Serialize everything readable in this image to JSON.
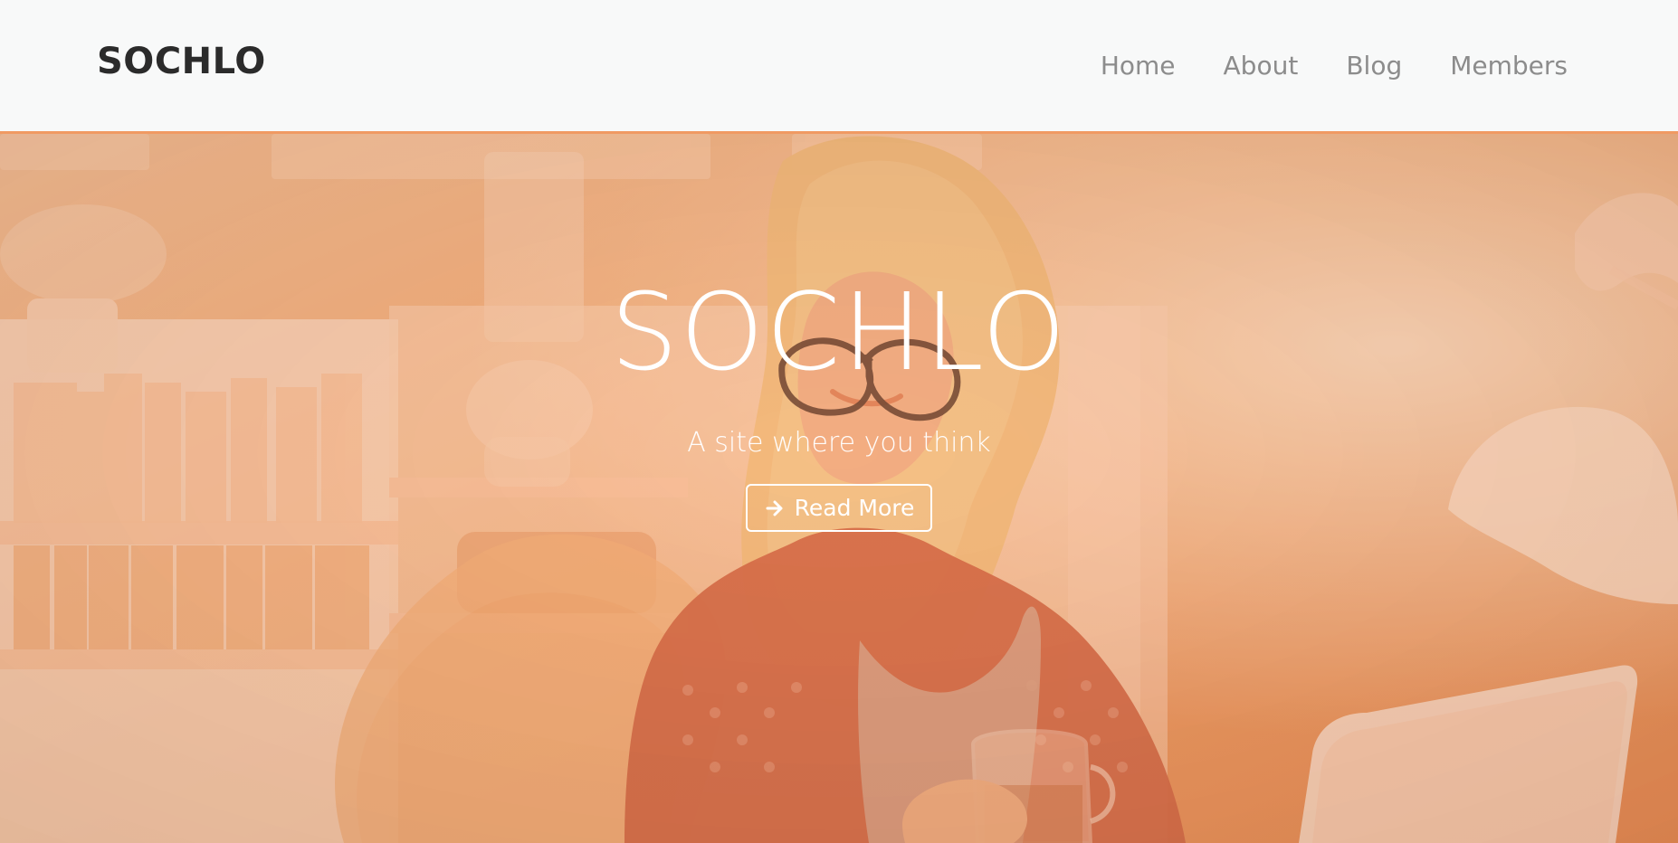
{
  "brand": "SOCHLO",
  "nav": {
    "items": [
      {
        "label": "Home"
      },
      {
        "label": "About"
      },
      {
        "label": "Blog"
      },
      {
        "label": "Members"
      }
    ]
  },
  "hero": {
    "title": "SOCHLO",
    "subtitle": "A site where you think",
    "cta_label": "Read More",
    "cta_icon": "arrow-right-icon"
  },
  "colors": {
    "navbar_bg": "#f8f9f9",
    "navbar_border": "#f09a63",
    "brand_text": "#2b2b2b",
    "nav_text": "#8c8c8c",
    "hero_overlay": "#f3a56b",
    "hero_text": "#ffffff"
  }
}
